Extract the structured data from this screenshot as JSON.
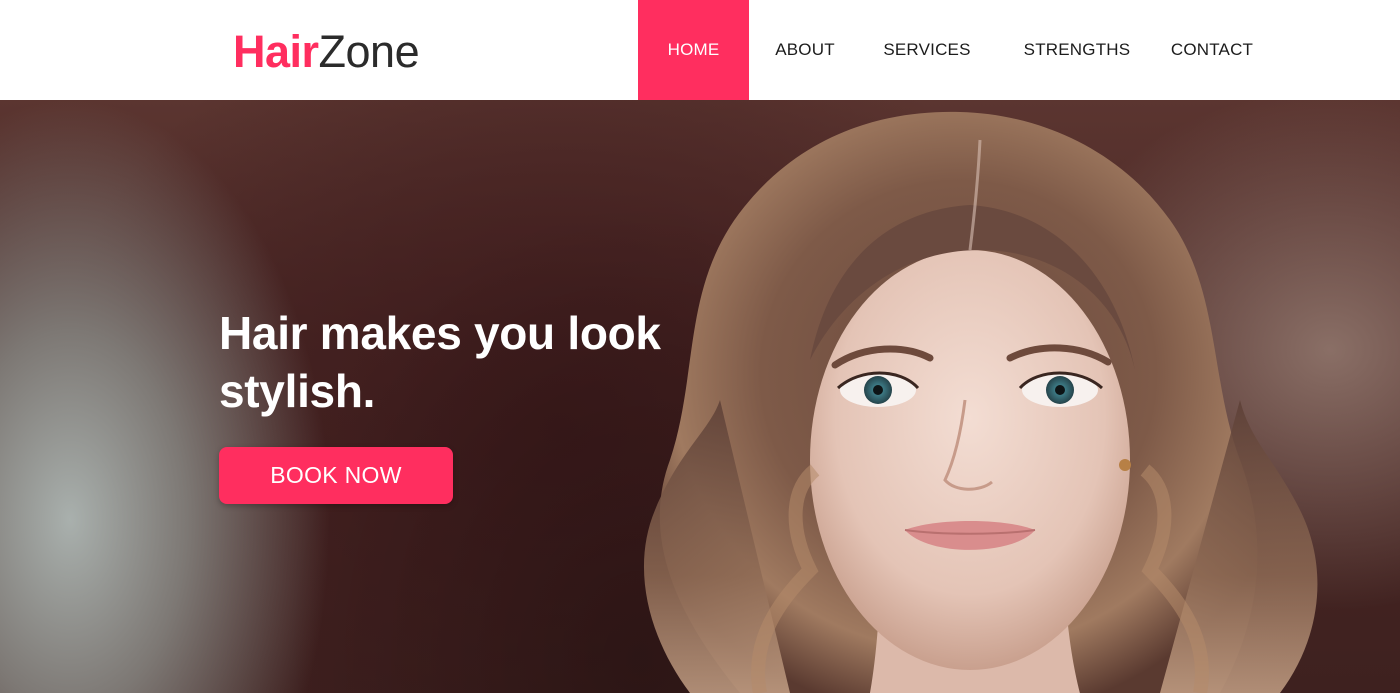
{
  "logo": {
    "part1": "Hair",
    "part2": "Zone"
  },
  "nav": {
    "home": "HOME",
    "about": "ABOUT",
    "services": "SERVICES",
    "strengths": "STRENGTHS",
    "contact": "CONTACT",
    "active": "HOME"
  },
  "hero": {
    "headline": "Hair makes you look stylish.",
    "cta_label": "BOOK NOW"
  },
  "colors": {
    "accent": "#ff2e5f",
    "nav_text": "#1c1c1c",
    "logo_dark": "#2b2b2b"
  }
}
